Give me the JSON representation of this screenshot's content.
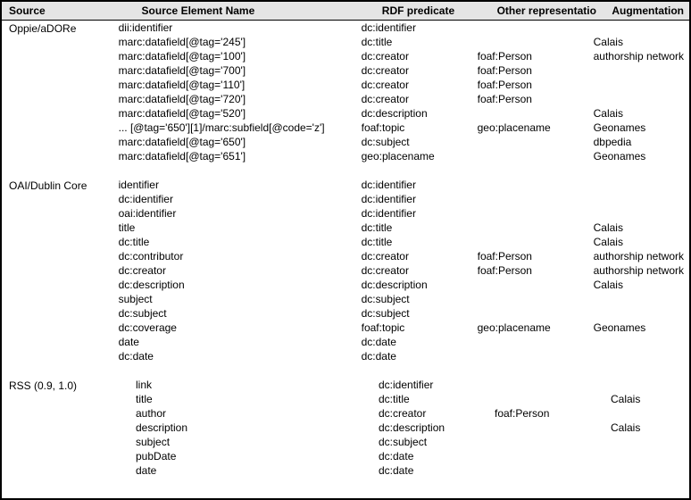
{
  "columns": {
    "source": "Source",
    "sename": "Source Element Name",
    "rdf": "RDF predicate",
    "other": "Other representatio",
    "aug": "Augmentation"
  },
  "groups": [
    {
      "source": "Oppie/aDORe",
      "rows": [
        {
          "sename": "dii:identifier",
          "rdf": "dc:identifier",
          "other": "",
          "aug": ""
        },
        {
          "sename": "marc:datafield[@tag='245']",
          "rdf": "dc:title",
          "other": "",
          "aug": "Calais"
        },
        {
          "sename": "marc:datafield[@tag='100']",
          "rdf": "dc:creator",
          "other": "foaf:Person",
          "aug": "authorship network"
        },
        {
          "sename": "marc:datafield[@tag='700']",
          "rdf": "dc:creator",
          "other": "foaf:Person",
          "aug": ""
        },
        {
          "sename": "marc:datafield[@tag='110']",
          "rdf": "dc:creator",
          "other": "foaf:Person",
          "aug": ""
        },
        {
          "sename": "marc:datafield[@tag='720']",
          "rdf": "dc:creator",
          "other": "foaf:Person",
          "aug": ""
        },
        {
          "sename": "marc:datafield[@tag='520']",
          "rdf": "dc:description",
          "other": "",
          "aug": "Calais"
        },
        {
          "sename": "... [@tag='650'][1]/marc:subfield[@code='z']",
          "rdf": "foaf:topic",
          "other": "geo:placename",
          "aug": "Geonames"
        },
        {
          "sename": "marc:datafield[@tag='650']",
          "rdf": "dc:subject",
          "other": "",
          "aug": "dbpedia"
        },
        {
          "sename": "marc:datafield[@tag='651']",
          "rdf": "geo:placename",
          "other": "",
          "aug": "Geonames"
        }
      ]
    },
    {
      "source": "OAI/Dublin Core",
      "rows": [
        {
          "sename": "identifier",
          "rdf": "dc:identifier",
          "other": "",
          "aug": ""
        },
        {
          "sename": "dc:identifier",
          "rdf": "dc:identifier",
          "other": "",
          "aug": ""
        },
        {
          "sename": "oai:identifier",
          "rdf": "dc:identifier",
          "other": "",
          "aug": ""
        },
        {
          "sename": "title",
          "rdf": "dc:title",
          "other": "",
          "aug": "Calais"
        },
        {
          "sename": "dc:title",
          "rdf": "dc:title",
          "other": "",
          "aug": "Calais"
        },
        {
          "sename": "dc:contributor",
          "rdf": "dc:creator",
          "other": "foaf:Person",
          "aug": "authorship network"
        },
        {
          "sename": "dc:creator",
          "rdf": "dc:creator",
          "other": "foaf:Person",
          "aug": "authorship network"
        },
        {
          "sename": "dc:description",
          "rdf": "dc:description",
          "other": "",
          "aug": "Calais"
        },
        {
          "sename": "subject",
          "rdf": "dc:subject",
          "other": "",
          "aug": ""
        },
        {
          "sename": "dc:subject",
          "rdf": "dc:subject",
          "other": "",
          "aug": ""
        },
        {
          "sename": "dc:coverage",
          "rdf": "foaf:topic",
          "other": "geo:placename",
          "aug": "Geonames"
        },
        {
          "sename": "date",
          "rdf": "dc:date",
          "other": "",
          "aug": ""
        },
        {
          "sename": "dc:date",
          "rdf": "dc:date",
          "other": "",
          "aug": ""
        }
      ]
    },
    {
      "source": "RSS (0.9, 1.0)",
      "rows": [
        {
          "sename": "link",
          "rdf": "dc:identifier",
          "other": "",
          "aug": ""
        },
        {
          "sename": "title",
          "rdf": "dc:title",
          "other": "",
          "aug": "Calais"
        },
        {
          "sename": "author",
          "rdf": "dc:creator",
          "other": "foaf:Person",
          "aug": ""
        },
        {
          "sename": "description",
          "rdf": "dc:description",
          "other": "",
          "aug": "Calais"
        },
        {
          "sename": "subject",
          "rdf": "dc:subject",
          "other": "",
          "aug": ""
        },
        {
          "sename": "pubDate",
          "rdf": "dc:date",
          "other": "",
          "aug": ""
        },
        {
          "sename": "date",
          "rdf": "dc:date",
          "other": "",
          "aug": ""
        }
      ]
    }
  ]
}
